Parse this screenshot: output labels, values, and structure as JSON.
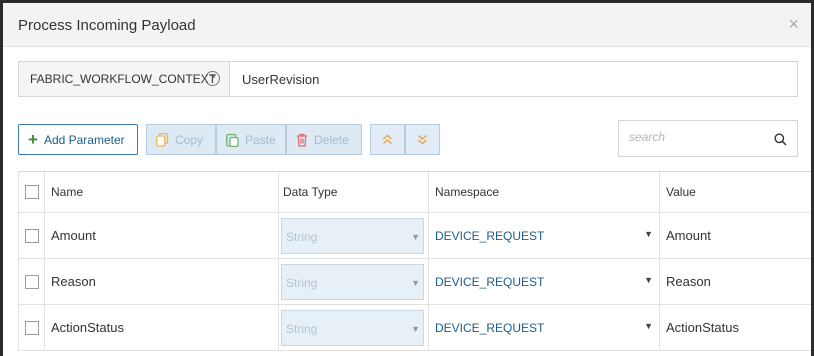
{
  "dialog": {
    "title": "Process Incoming Payload",
    "close_glyph": "×"
  },
  "context": {
    "label": "FABRIC_WORKFLOW_CONTEXT",
    "help_glyph": "?",
    "value": "UserRevision"
  },
  "toolbar": {
    "add_label": "Add Parameter",
    "copy_label": "Copy",
    "paste_label": "Paste",
    "delete_label": "Delete",
    "move_up_glyph": "»",
    "move_down_glyph": "»"
  },
  "search": {
    "placeholder": "search",
    "value": ""
  },
  "table": {
    "headers": {
      "name": "Name",
      "data_type": "Data Type",
      "namespace": "Namespace",
      "value": "Value"
    },
    "rows": [
      {
        "name": "Amount",
        "data_type": "String",
        "namespace": "DEVICE_REQUEST",
        "value": "Amount"
      },
      {
        "name": "Reason",
        "data_type": "String",
        "namespace": "DEVICE_REQUEST",
        "value": "Reason"
      },
      {
        "name": "ActionStatus",
        "data_type": "String",
        "namespace": "DEVICE_REQUEST",
        "value": "ActionStatus"
      }
    ]
  },
  "icons": {
    "add": "plus-icon",
    "copy": "copy-icon",
    "paste": "paste-icon",
    "delete": "trash-icon",
    "move_up": "double-chevron-up-icon",
    "move_down": "double-chevron-down-icon",
    "search": "search-icon",
    "help": "help-circle-icon",
    "close": "close-icon"
  },
  "colors": {
    "accent": "#1d5c8e",
    "add_icon": "#3b8f3b",
    "disabled_icon": "#f0b450",
    "delete_icon": "#e06b6b",
    "move_icon": "#e8a03a"
  }
}
